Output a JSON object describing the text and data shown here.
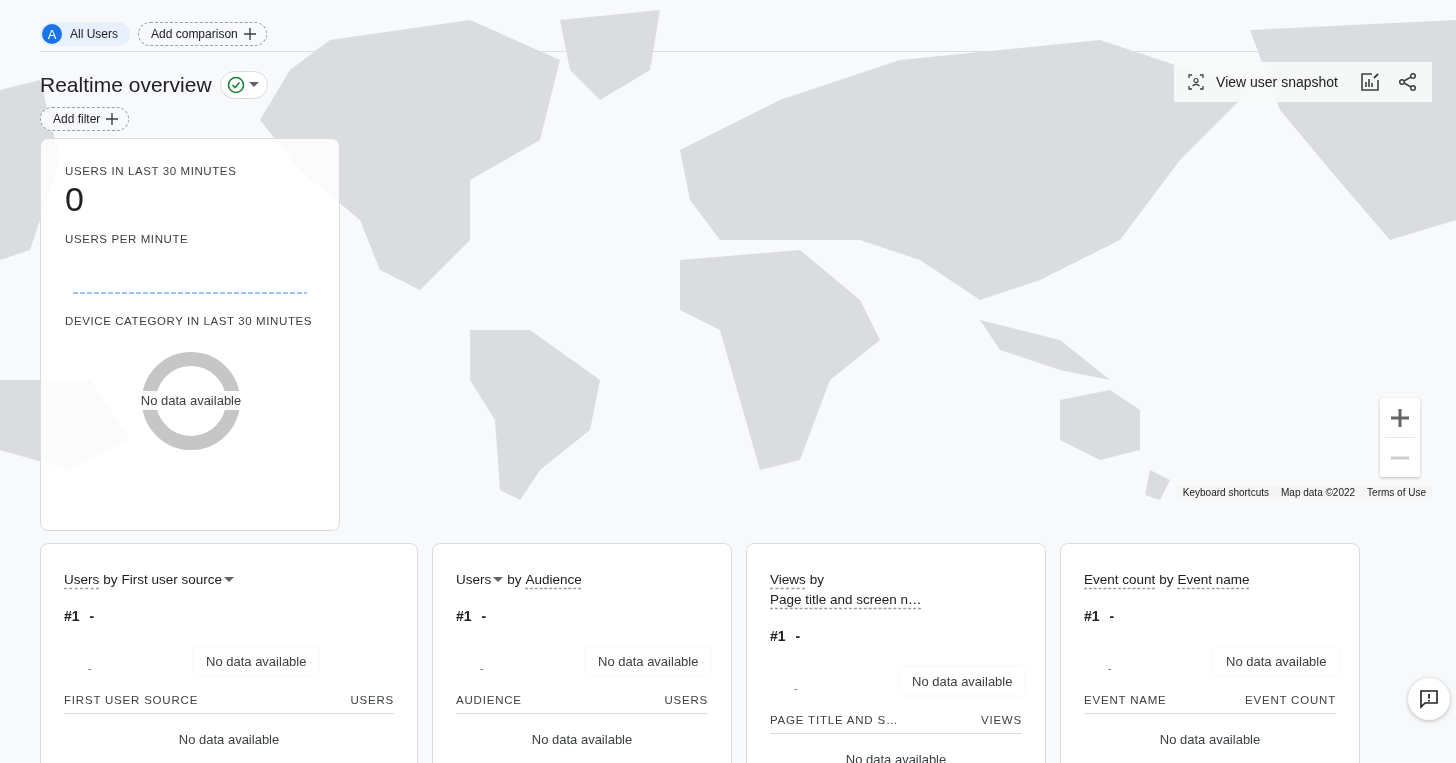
{
  "comparison_bar": {
    "chips": [
      {
        "kind": "audience",
        "badge": "A",
        "label": "All Users"
      },
      {
        "kind": "add",
        "label": "Add comparison"
      }
    ]
  },
  "header": {
    "title": "Realtime overview",
    "add_filter": "Add filter"
  },
  "toolbar": {
    "snapshot": "View user snapshot"
  },
  "summary_card": {
    "users_label": "USERS IN LAST 30 MINUTES",
    "users_value": "0",
    "per_minute_label": "USERS PER MINUTE",
    "device_label": "DEVICE CATEGORY IN LAST 30 MINUTES",
    "device_empty": "No data available"
  },
  "map": {
    "attribution": [
      "Keyboard shortcuts",
      "Map data ©2022",
      "Terms of Use"
    ]
  },
  "report_cards": [
    {
      "title": [
        {
          "kind": "picker",
          "text": "Users",
          "underlined": true,
          "caret": false
        },
        {
          "kind": "text",
          "text": "by"
        },
        {
          "kind": "picker",
          "text": "First user source",
          "underlined": false,
          "caret": true
        }
      ],
      "rank": "#1",
      "top_value": "-",
      "bar_value": "-",
      "bar_empty": "No data available",
      "columns": [
        "FIRST USER SOURCE",
        "USERS"
      ],
      "table_empty": "No data available"
    },
    {
      "title": [
        {
          "kind": "picker",
          "text": "Users",
          "underlined": false,
          "caret": true
        },
        {
          "kind": "text",
          "text": "by"
        },
        {
          "kind": "picker",
          "text": "Audience",
          "underlined": true,
          "caret": false
        }
      ],
      "rank": "#1",
      "top_value": "-",
      "bar_value": "-",
      "bar_empty": "No data available",
      "columns": [
        "AUDIENCE",
        "USERS"
      ],
      "table_empty": "No data available"
    },
    {
      "title": [
        {
          "kind": "picker",
          "text": "Views",
          "underlined": true,
          "caret": false
        },
        {
          "kind": "text",
          "text": "by"
        },
        {
          "kind": "picker",
          "text": "Page title and screen n…",
          "underlined": true,
          "caret": false
        }
      ],
      "rank": "#1",
      "top_value": "-",
      "bar_value": "-",
      "bar_empty": "No data available",
      "columns": [
        "PAGE TITLE AND S…",
        "VIEWS"
      ],
      "table_empty": "No data available"
    },
    {
      "title": [
        {
          "kind": "picker",
          "text": "Event count",
          "underlined": true,
          "caret": false
        },
        {
          "kind": "text",
          "text": "by"
        },
        {
          "kind": "picker",
          "text": "Event name",
          "underlined": true,
          "caret": false
        }
      ],
      "rank": "#1",
      "top_value": "-",
      "bar_value": "-",
      "bar_empty": "No data available",
      "columns": [
        "EVENT NAME",
        "EVENT COUNT"
      ],
      "table_empty": "No data available"
    }
  ]
}
